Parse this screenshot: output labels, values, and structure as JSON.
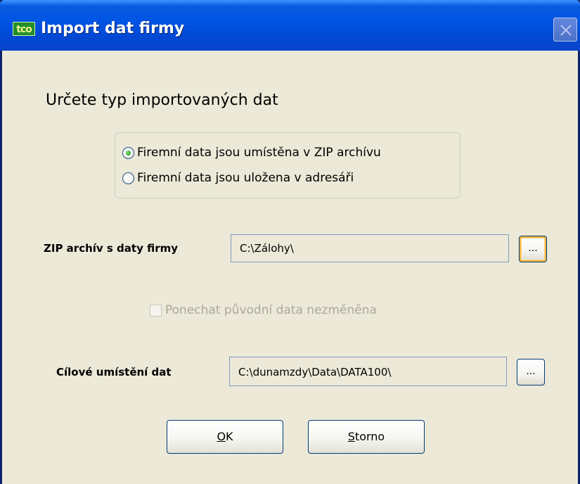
{
  "window": {
    "title": "Import dat firmy",
    "app_icon_text": "tco",
    "close_icon": "close-icon"
  },
  "heading": "Určete typ importovaných dat",
  "source_type": {
    "options": [
      {
        "label": "Firemní data jsou umístěna v ZIP archívu",
        "selected": true
      },
      {
        "label": "Firemní data jsou uložena v adresáři",
        "selected": false
      }
    ]
  },
  "zip_field": {
    "label": "ZIP archív s daty firmy",
    "value": "C:\\Zálohy\\",
    "browse_label": "..."
  },
  "keep_original": {
    "label": "Ponechat původní data nezměněna",
    "checked": false,
    "enabled": false
  },
  "target_field": {
    "label": "Cílové umístění dat",
    "value": "C:\\dunamzdy\\Data\\DATA100\\",
    "browse_label": "..."
  },
  "buttons": {
    "ok_label_mnemonic": "O",
    "ok_label_rest": "K",
    "cancel_label_mnemonic": "S",
    "cancel_label_rest": "torno"
  },
  "colors": {
    "titlebar": "#0055e5",
    "dialog_bg": "#ece9d8",
    "disabled_text": "#aca899",
    "radio_selected": "#2bb22b",
    "focus_ring": "#f8b33e"
  }
}
